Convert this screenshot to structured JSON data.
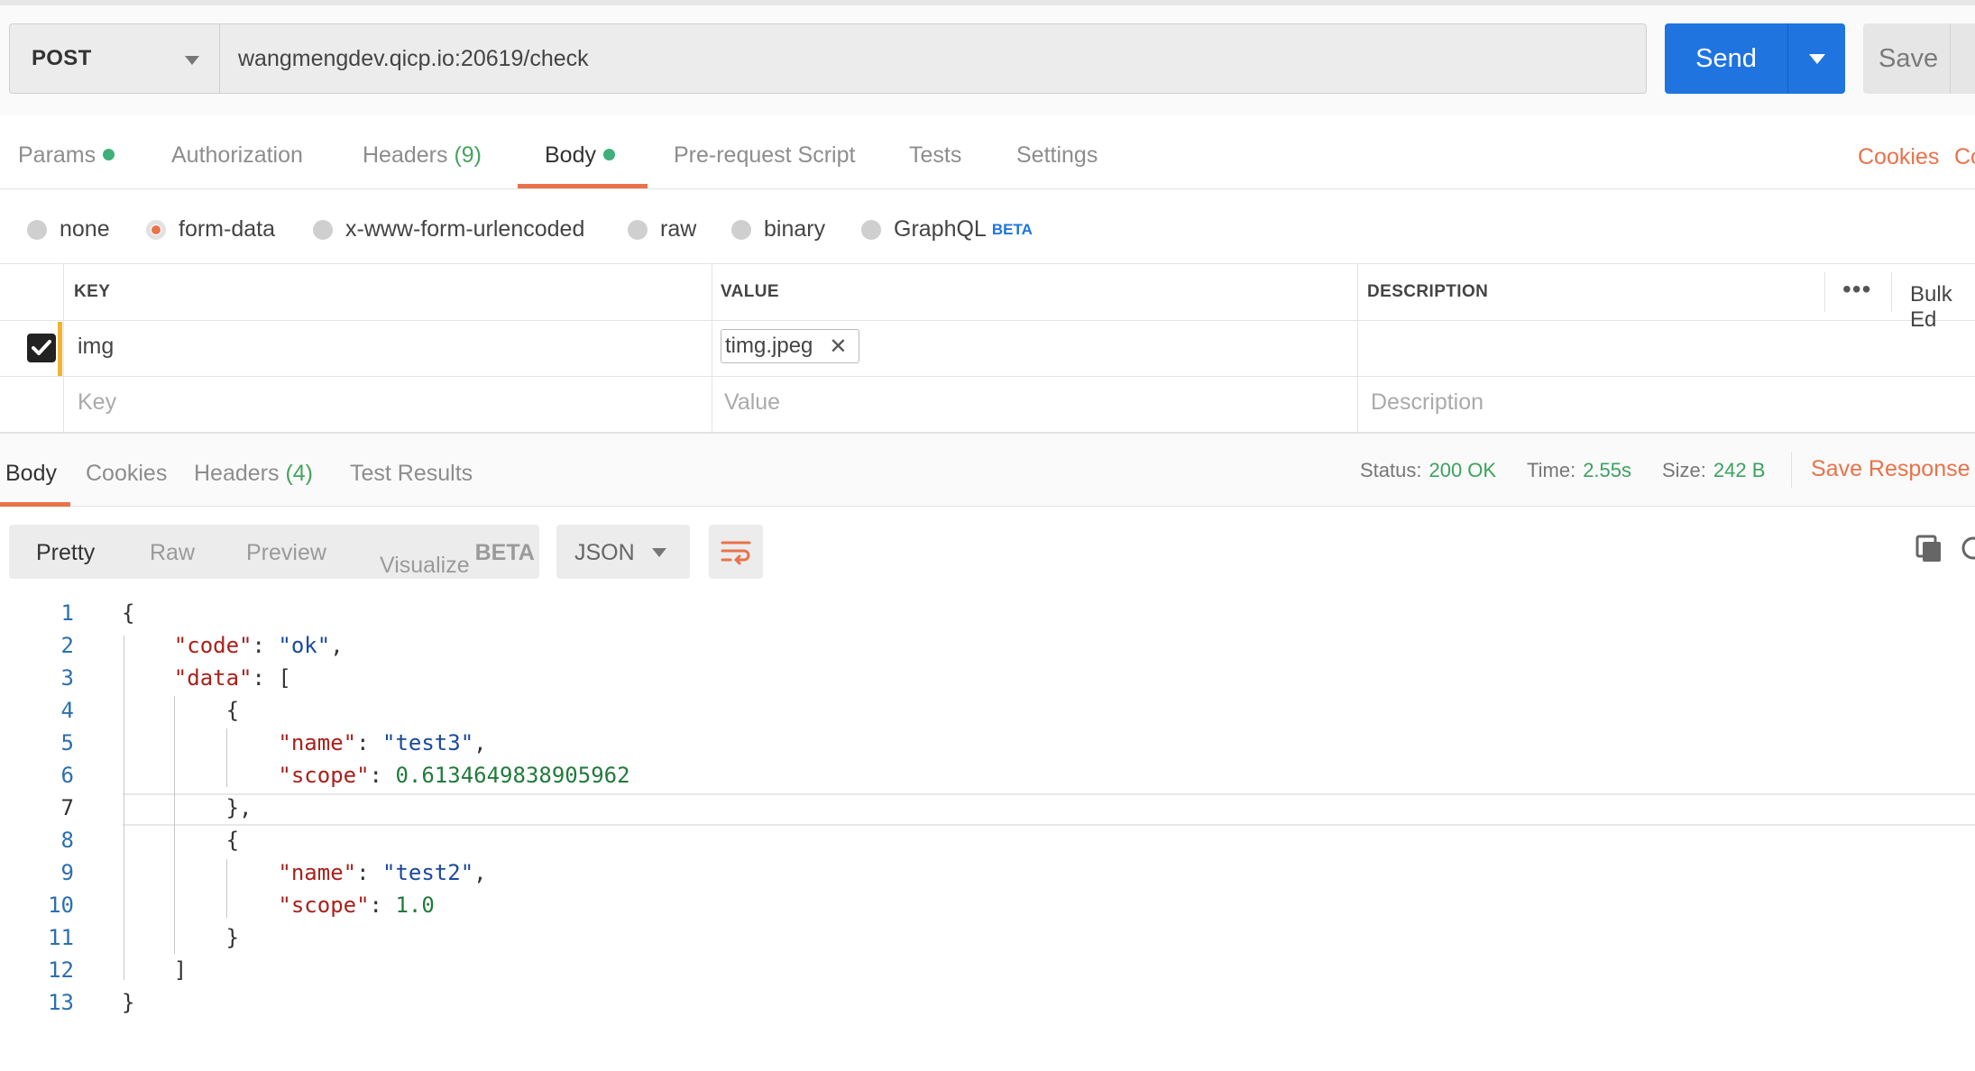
{
  "request": {
    "method": "POST",
    "url": "wangmengdev.qicp.io:20619/check",
    "send_label": "Send",
    "save_label": "Save"
  },
  "request_tabs": [
    {
      "label": "Params",
      "dot": true
    },
    {
      "label": "Authorization"
    },
    {
      "label": "Headers",
      "count": "(9)"
    },
    {
      "label": "Body",
      "dot": true,
      "active": true
    },
    {
      "label": "Pre-request Script"
    },
    {
      "label": "Tests"
    },
    {
      "label": "Settings"
    }
  ],
  "right_links": {
    "cookies": "Cookies",
    "code": "Co"
  },
  "body_types": [
    {
      "label": "none"
    },
    {
      "label": "form-data",
      "selected": true
    },
    {
      "label": "x-www-form-urlencoded"
    },
    {
      "label": "raw"
    },
    {
      "label": "binary"
    },
    {
      "label": "GraphQL",
      "badge": "BETA"
    }
  ],
  "params_table": {
    "headers": {
      "key": "KEY",
      "value": "VALUE",
      "description": "DESCRIPTION"
    },
    "bulk_edit": "Bulk Ed",
    "rows": [
      {
        "checked": true,
        "key": "img",
        "value_file": "timg.jpeg",
        "description": ""
      }
    ],
    "placeholders": {
      "key": "Key",
      "value": "Value",
      "description": "Description"
    }
  },
  "response_tabs": [
    {
      "label": "Body",
      "active": true
    },
    {
      "label": "Cookies"
    },
    {
      "label": "Headers",
      "count": "(4)"
    },
    {
      "label": "Test Results"
    }
  ],
  "response_meta": {
    "status_label": "Status:",
    "status_value": "200 OK",
    "time_label": "Time:",
    "time_value": "2.55s",
    "size_label": "Size:",
    "size_value": "242 B",
    "save_response": "Save Response"
  },
  "format_modes": [
    {
      "label": "Pretty",
      "active": true
    },
    {
      "label": "Raw"
    },
    {
      "label": "Preview"
    },
    {
      "label": "Visualize",
      "badge": "BETA"
    }
  ],
  "language": "JSON",
  "response_body": {
    "current_line": 7,
    "lines": [
      {
        "n": "1"
      },
      {
        "n": "2"
      },
      {
        "n": "3"
      },
      {
        "n": "4"
      },
      {
        "n": "5"
      },
      {
        "n": "6"
      },
      {
        "n": "7"
      },
      {
        "n": "8"
      },
      {
        "n": "9"
      },
      {
        "n": "10"
      },
      {
        "n": "11"
      },
      {
        "n": "12"
      },
      {
        "n": "13"
      }
    ],
    "json": {
      "code_key": "\"code\"",
      "code_val": "\"ok\"",
      "data_key": "\"data\"",
      "item1": {
        "name_key": "\"name\"",
        "name_val": "\"test3\"",
        "scope_key": "\"scope\"",
        "scope_val": "0.6134649838905962"
      },
      "item2": {
        "name_key": "\"name\"",
        "name_val": "\"test2\"",
        "scope_key": "\"scope\"",
        "scope_val": "1.0"
      }
    }
  },
  "colors": {
    "accent": "#e9724a",
    "send": "#1f74e0",
    "status_green": "#3aa25e",
    "dot_green": "#3fb07a"
  }
}
